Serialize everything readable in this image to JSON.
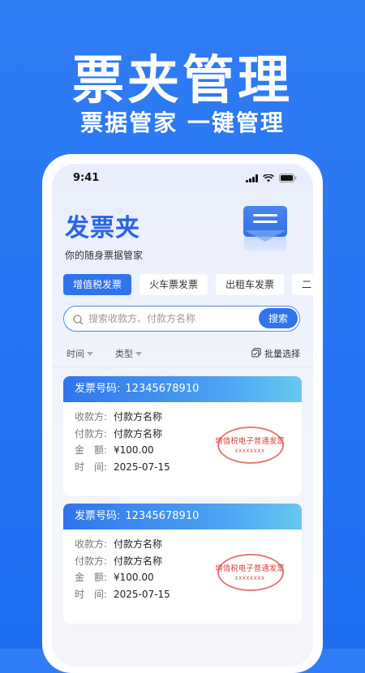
{
  "hero": {
    "title": "票夹管理",
    "subtitle": "票据管家 一键管理"
  },
  "status_bar": {
    "time": "9:41"
  },
  "app": {
    "title": "发票夹",
    "subtitle": "你的随身票据管家"
  },
  "tabs": [
    {
      "label": "增值税发票",
      "active": true
    },
    {
      "label": "火车票发票",
      "active": false
    },
    {
      "label": "出租车发票",
      "active": false
    },
    {
      "label": "二",
      "active": false
    }
  ],
  "search": {
    "placeholder": "搜索收款方、付款方名称",
    "button_label": "搜索"
  },
  "filters": {
    "time_label": "时间",
    "type_label": "类型",
    "batch_label": "批量选择"
  },
  "invoices": [
    {
      "header_label": "发票号码:",
      "number": "12345678910",
      "payee_label": "收款方:",
      "payee": "付款方名称",
      "payer_label": "付款方:",
      "payer": "付款方名称",
      "amount_label": "金　额:",
      "amount": "¥100.00",
      "date_label": "时　间:",
      "date": "2025-07-15",
      "stamp_text": "增值税电子普通发票",
      "stamp_code": "XXXXXXXX"
    },
    {
      "header_label": "发票号码:",
      "number": "12345678910",
      "payee_label": "收款方:",
      "payee": "付款方名称",
      "payer_label": "付款方:",
      "payer": "付款方名称",
      "amount_label": "金　额:",
      "amount": "¥100.00",
      "date_label": "时　间:",
      "date": "2025-07-15",
      "stamp_text": "增值税电子普通发票",
      "stamp_code": "XXXXXXXX"
    }
  ],
  "colors": {
    "brand": "#2f74ec",
    "stamp": "#d84545",
    "title": "#2a64e8"
  }
}
